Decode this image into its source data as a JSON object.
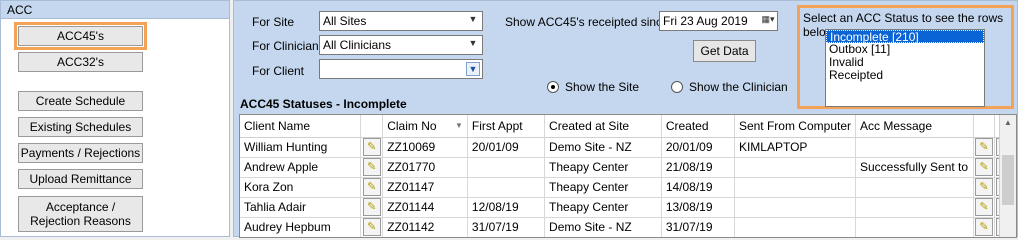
{
  "nav": {
    "header": "ACC",
    "buttons": {
      "acc45": "ACC45's",
      "acc32": "ACC32's",
      "create_schedule": "Create Schedule",
      "existing_schedules": "Existing Schedules",
      "payments": "Payments / Rejections",
      "upload": "Upload Remittance",
      "acceptance_line1": "Acceptance /",
      "acceptance_line2": "Rejection Reasons"
    }
  },
  "filters": {
    "site_label": "For Site",
    "site_value": "All Sites",
    "clinician_label": "For Clinician",
    "clinician_value": "All Clinicians",
    "client_label": "For Client",
    "client_value": "",
    "since_label": "Show ACC45's receipted since",
    "date_value": "Fri   23 Aug 2019",
    "get_data": "Get Data",
    "show_site": "Show the Site",
    "show_clinician": "Show the Clinician"
  },
  "status": {
    "title": "Select an ACC Status to see the rows below",
    "items": [
      "Incomplete  [210]",
      "Outbox  [11]",
      "Invalid",
      "Receipted"
    ]
  },
  "grid": {
    "title": "ACC45 Statuses - Incomplete",
    "columns": [
      "Client Name",
      "Claim No",
      "First Appt",
      "Created at Site",
      "Created",
      "Sent From Computer",
      "Acc Message"
    ],
    "rows": [
      [
        "William Hunting",
        "ZZ10069",
        "20/01/09",
        "Demo Site - NZ",
        "20/01/09",
        "KIMLAPTOP",
        ""
      ],
      [
        "Andrew Apple",
        "ZZ01770",
        "",
        "Theapy Center",
        "21/08/19",
        "",
        "Successfully Sent to"
      ],
      [
        "Kora Zon",
        "ZZ01147",
        "",
        "Theapy Center",
        "14/08/19",
        "",
        ""
      ],
      [
        "Tahlia Adair",
        "ZZ01144",
        "12/08/19",
        "Theapy Center",
        "13/08/19",
        "",
        ""
      ],
      [
        "Audrey Hepbum",
        "ZZ01142",
        "31/07/19",
        "Demo Site - NZ",
        "31/07/19",
        "",
        ""
      ]
    ]
  }
}
